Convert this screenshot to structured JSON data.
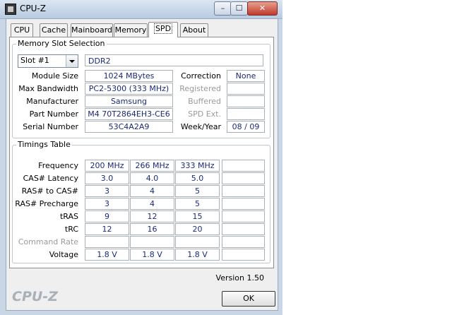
{
  "window": {
    "title": "CPU-Z",
    "min_glyph": "–",
    "max_glyph": "☐",
    "close_glyph": "✕"
  },
  "tabs": [
    {
      "label": "CPU"
    },
    {
      "label": "Cache"
    },
    {
      "label": "Mainboard"
    },
    {
      "label": "Memory"
    },
    {
      "label": "SPD",
      "active": true
    },
    {
      "label": "About"
    }
  ],
  "slot": {
    "group_title": "Memory Slot Selection",
    "selected": "Slot #1",
    "type": "DDR2",
    "fields": {
      "module_size": {
        "label": "Module Size",
        "value": "1024 MBytes"
      },
      "max_bandwidth": {
        "label": "Max Bandwidth",
        "value": "PC2-5300 (333 MHz)"
      },
      "manufacturer": {
        "label": "Manufacturer",
        "value": "Samsung"
      },
      "part_number": {
        "label": "Part Number",
        "value": "M4 70T2864EH3-CE6"
      },
      "serial_number": {
        "label": "Serial Number",
        "value": "53C4A2A9"
      },
      "correction": {
        "label": "Correction",
        "value": "None"
      },
      "registered": {
        "label": "Registered",
        "value": ""
      },
      "buffered": {
        "label": "Buffered",
        "value": ""
      },
      "spd_ext": {
        "label": "SPD Ext.",
        "value": ""
      },
      "week_year": {
        "label": "Week/Year",
        "value": "08 / 09"
      }
    }
  },
  "timings": {
    "group_title": "Timings Table",
    "rows": [
      {
        "label": "Frequency",
        "values": [
          "200 MHz",
          "266 MHz",
          "333 MHz",
          ""
        ]
      },
      {
        "label": "CAS# Latency",
        "values": [
          "3.0",
          "4.0",
          "5.0",
          ""
        ]
      },
      {
        "label": "RAS# to CAS#",
        "values": [
          "3",
          "4",
          "5",
          ""
        ]
      },
      {
        "label": "RAS# Precharge",
        "values": [
          "3",
          "4",
          "5",
          ""
        ]
      },
      {
        "label": "tRAS",
        "values": [
          "9",
          "12",
          "15",
          ""
        ]
      },
      {
        "label": "tRC",
        "values": [
          "12",
          "16",
          "20",
          ""
        ]
      },
      {
        "label": "Command Rate",
        "values": [
          "",
          "",
          "",
          ""
        ],
        "dim": true
      },
      {
        "label": "Voltage",
        "values": [
          "1.8 V",
          "1.8 V",
          "1.8 V",
          ""
        ]
      }
    ]
  },
  "footer": {
    "version": "Version 1.50",
    "brand": "CPU-Z",
    "ok_label": "OK"
  }
}
